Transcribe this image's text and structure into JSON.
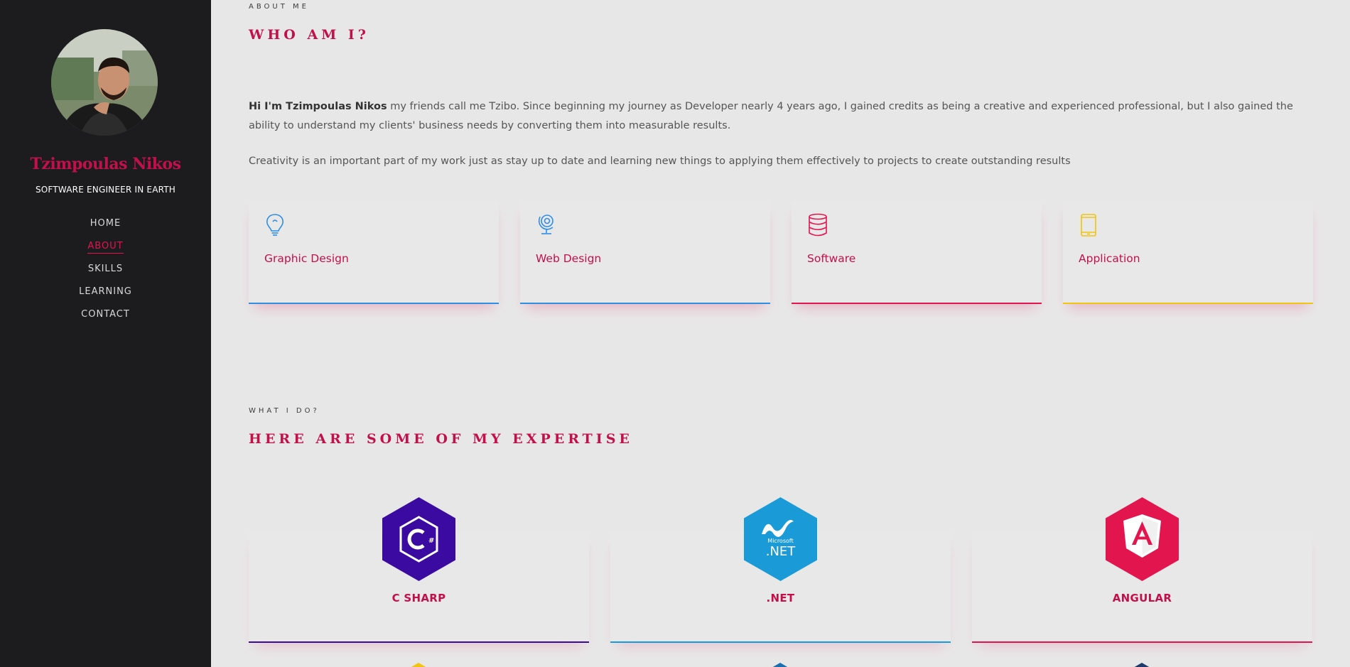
{
  "sidebar": {
    "name": "Tzimpoulas Nikos",
    "role": "SOFTWARE ENGINEER IN EARTH",
    "nav": [
      {
        "label": "HOME"
      },
      {
        "label": "ABOUT"
      },
      {
        "label": "SKILLS"
      },
      {
        "label": "LEARNING"
      },
      {
        "label": "CONTACT"
      }
    ],
    "active_item": "ABOUT"
  },
  "about": {
    "overline": "ABOUT ME",
    "heading": "WHO AM I?",
    "intro_strong": "Hi I'm Tzimpoulas Nikos",
    "intro_rest": " my friends call me Tzibo. Since beginning my journey as Developer nearly 4 years ago, I gained credits as being a creative and experienced professional, but I also gained the ability to understand my clients' business needs by converting them into measurable results.",
    "paragraph2": "Creativity is an important part of my work just as stay up to date and learning new things to applying them effectively to projects to create outstanding results"
  },
  "services": [
    {
      "label": "Graphic Design",
      "icon": "lightbulb-icon",
      "color": "#2f8de4"
    },
    {
      "label": "Web Design",
      "icon": "globe-icon",
      "color": "#2f8de4"
    },
    {
      "label": "Software",
      "icon": "database-icon",
      "color": "#e2154f"
    },
    {
      "label": "Application",
      "icon": "phone-icon",
      "color": "#f1c40f"
    }
  ],
  "expertise": {
    "overline": "WHAT I DO?",
    "heading": "HERE ARE SOME OF MY EXPERTISE",
    "skills": [
      {
        "label": "C SHARP",
        "icon": "csharp-icon",
        "color": "#3b0aa0",
        "logo_text": "C#"
      },
      {
        "label": ".NET",
        "icon": "dotnet-icon",
        "color": "#1a9ad6",
        "logo_text": ".NET",
        "logo_subtext": "Microsoft"
      },
      {
        "label": "ANGULAR",
        "icon": "angular-icon",
        "color": "#e2154f",
        "logo_text": "A"
      }
    ]
  },
  "colors": {
    "accent": "#c2104b",
    "sidebar_bg": "#1c1c1f",
    "page_bg": "#e8e7e8"
  }
}
